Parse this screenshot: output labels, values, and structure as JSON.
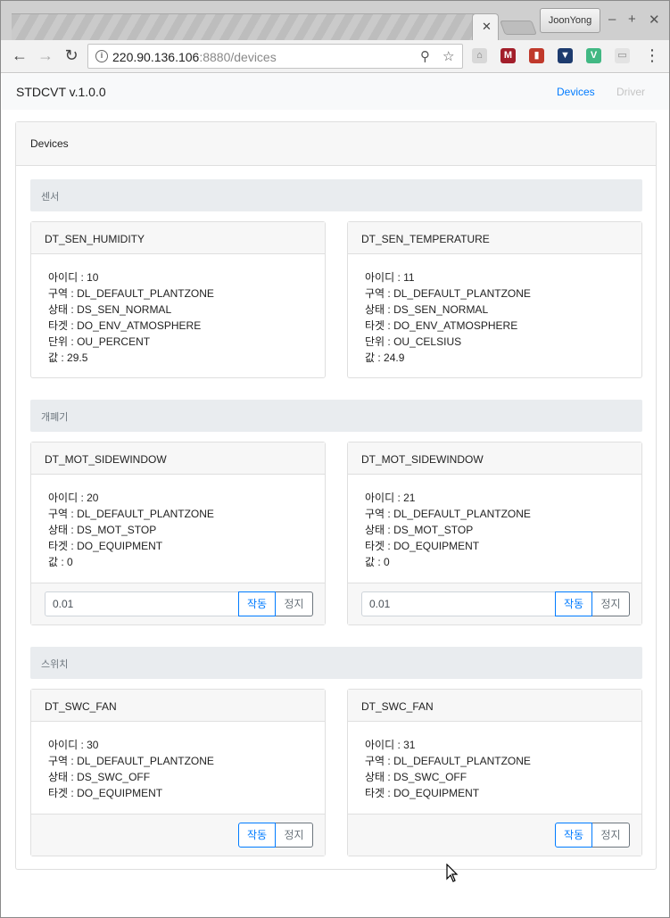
{
  "browser": {
    "profile_name": "JoonYong",
    "url_host": "220.90.136.106",
    "url_rest": ":8880/devices"
  },
  "app": {
    "brand": "STDCVT  v.1.0.0",
    "nav": {
      "devices": "Devices",
      "driver": "Driver"
    },
    "page_header": "Devices"
  },
  "sections": {
    "sensor": {
      "title": "센서",
      "cards": [
        {
          "name": "DT_SEN_HUMIDITY",
          "id": "아이디 : 10",
          "zone": "구역 : DL_DEFAULT_PLANTZONE",
          "status": "상태 : DS_SEN_NORMAL",
          "target": "타겟 : DO_ENV_ATMOSPHERE",
          "unit": "단위 : OU_PERCENT",
          "value": "값 : 29.5"
        },
        {
          "name": "DT_SEN_TEMPERATURE",
          "id": "아이디 : 11",
          "zone": "구역 : DL_DEFAULT_PLANTZONE",
          "status": "상태 : DS_SEN_NORMAL",
          "target": "타겟 : DO_ENV_ATMOSPHERE",
          "unit": "단위 : OU_CELSIUS",
          "value": "값 : 24.9"
        }
      ]
    },
    "motor": {
      "title": "개폐기",
      "cards": [
        {
          "name": "DT_MOT_SIDEWINDOW",
          "id": "아이디 : 20",
          "zone": "구역 : DL_DEFAULT_PLANTZONE",
          "status": "상태 : DS_MOT_STOP",
          "target": "타겟 : DO_EQUIPMENT",
          "value": "값 : 0",
          "input_value": "0.01",
          "run_label": "작동",
          "stop_label": "정지"
        },
        {
          "name": "DT_MOT_SIDEWINDOW",
          "id": "아이디 : 21",
          "zone": "구역 : DL_DEFAULT_PLANTZONE",
          "status": "상태 : DS_MOT_STOP",
          "target": "타겟 : DO_EQUIPMENT",
          "value": "값 : 0",
          "input_value": "0.01",
          "run_label": "작동",
          "stop_label": "정지"
        }
      ]
    },
    "switch": {
      "title": "스위치",
      "cards": [
        {
          "name": "DT_SWC_FAN",
          "id": "아이디 : 30",
          "zone": "구역 : DL_DEFAULT_PLANTZONE",
          "status": "상태 : DS_SWC_OFF",
          "target": "타겟 : DO_EQUIPMENT",
          "run_label": "작동",
          "stop_label": "정지"
        },
        {
          "name": "DT_SWC_FAN",
          "id": "아이디 : 31",
          "zone": "구역 : DL_DEFAULT_PLANTZONE",
          "status": "상태 : DS_SWC_OFF",
          "target": "타겟 : DO_EQUIPMENT",
          "run_label": "작동",
          "stop_label": "정지"
        }
      ]
    }
  },
  "icons": {
    "back": "arrow-left-icon",
    "forward": "arrow-right-icon",
    "reload": "reload-icon",
    "info": "info-icon",
    "zoom": "magnifier-icon",
    "bookmark": "star-icon",
    "menu": "kebab-menu-icon"
  },
  "colors": {
    "primary": "#007bff",
    "secondary": "#6c757d",
    "section_bg": "#e9ecef",
    "card_header_bg": "#f7f7f7"
  }
}
